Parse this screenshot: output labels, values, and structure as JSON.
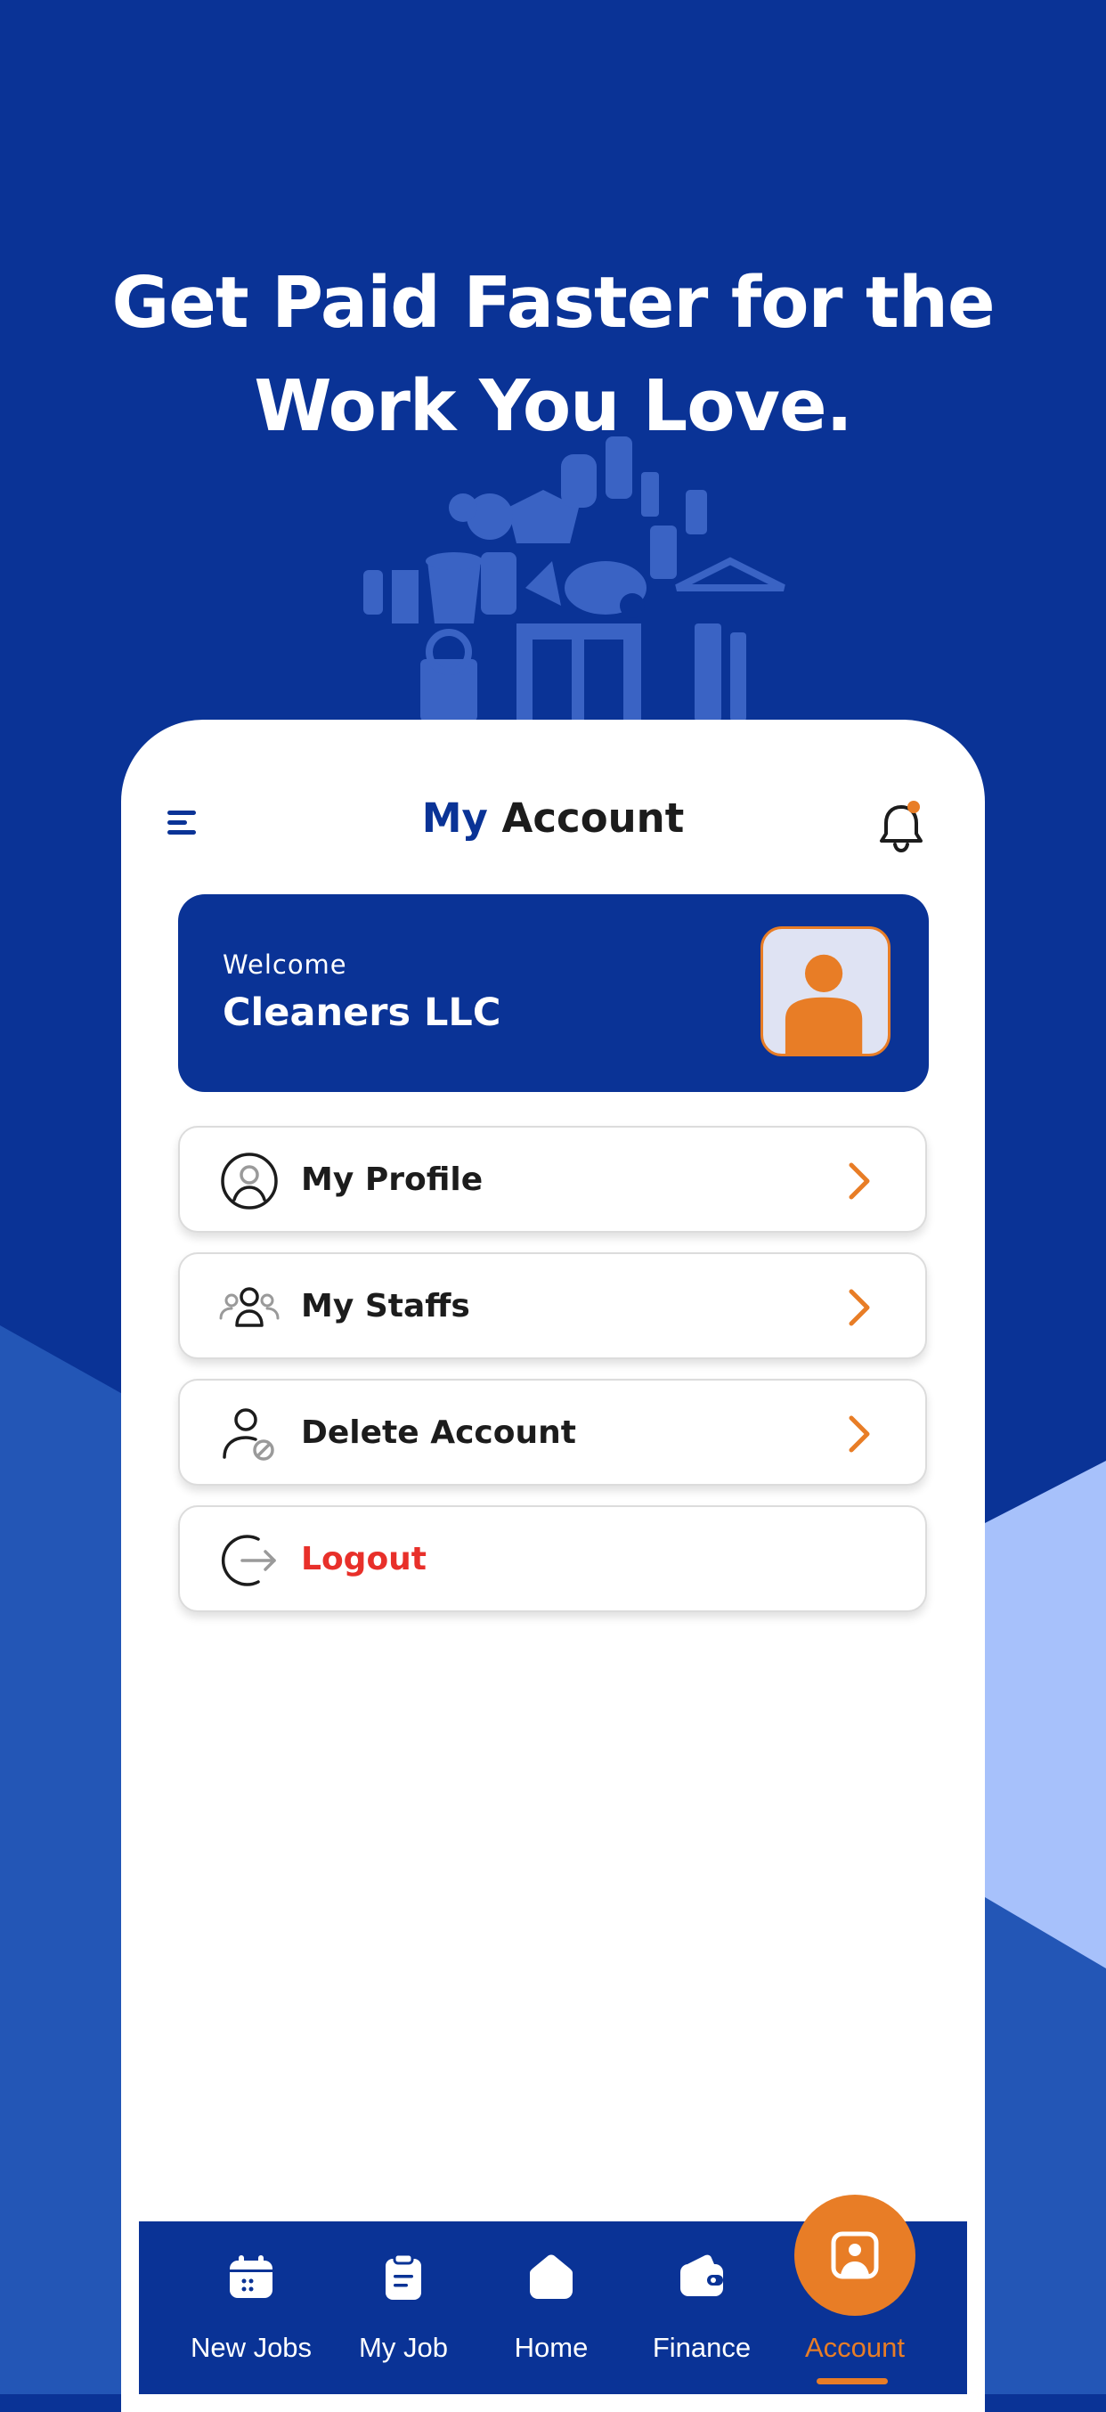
{
  "headline": {
    "line1": "Get Paid Faster for the",
    "line2": "Work You Love."
  },
  "colors": {
    "primary": "#0a3396",
    "accent": "#e87d26",
    "danger": "#e8302a",
    "light_blue": "#a7c1fb",
    "mid_blue": "#2356b6"
  },
  "header": {
    "title_part1": "My",
    "title_part2": " Account",
    "menu_icon": "hamburger-icon",
    "bell_icon": "bell-icon",
    "has_notification": true
  },
  "welcome_card": {
    "label": "Welcome",
    "name": "Cleaners LLC",
    "avatar_icon": "user-avatar-icon"
  },
  "menu": {
    "items": [
      {
        "label": "My Profile",
        "icon": "user-circle-icon"
      },
      {
        "label": "My Staffs",
        "icon": "users-group-icon"
      },
      {
        "label": "Delete Account",
        "icon": "user-remove-icon"
      },
      {
        "label": "Logout",
        "icon": "logout-icon"
      }
    ]
  },
  "bottom_nav": {
    "items": [
      {
        "label": "New Jobs",
        "icon": "calendar-icon"
      },
      {
        "label": "My Job",
        "icon": "clipboard-icon"
      },
      {
        "label": "Home",
        "icon": "home-icon"
      },
      {
        "label": "Finance",
        "icon": "wallet-icon"
      },
      {
        "label": "Account",
        "icon": "account-icon",
        "active": true
      }
    ]
  }
}
